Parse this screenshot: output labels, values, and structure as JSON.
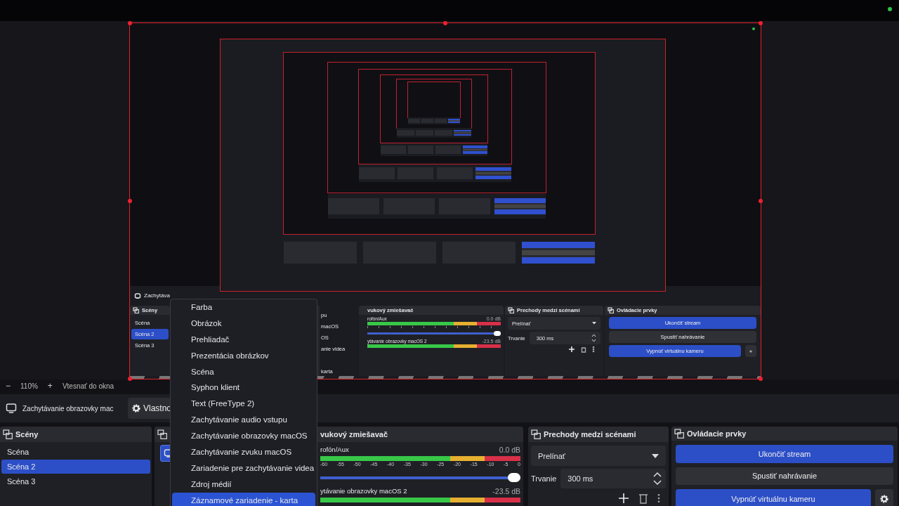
{
  "preview": {
    "nested_capture": {
      "toolbar_source": "Zachytáva",
      "scenes": {
        "title": "Scény",
        "items": [
          {
            "label": "Scéna",
            "selected": false
          },
          {
            "label": "Scéna 2",
            "selected": true
          },
          {
            "label": "Scéna 3",
            "selected": false
          }
        ]
      },
      "menu_fragments": [
        "pu",
        "macOS",
        "OS",
        "anie videa",
        "karta"
      ],
      "mixer": {
        "title": "vukový zmiešavač",
        "channels": [
          {
            "name": "rofón/Aux",
            "reading": "0.0 dB",
            "level": 1
          },
          {
            "name": "ytávanie obrazovky macOS 2",
            "reading": "-23.5 dB"
          }
        ]
      },
      "transitions": {
        "title": "Prechody medzi scénami",
        "transition": "Prelínať",
        "duration_label": "Trvanie",
        "duration": "300 ms"
      },
      "controls": {
        "title": "Ovládacie prvky",
        "buttons": [
          {
            "label": "Ukončiť stream",
            "kind": "primary"
          },
          {
            "label": "Spustiť nahrávanie",
            "kind": "secondary"
          },
          {
            "label": "Vypnúť virtuálnu kameru",
            "kind": "primary"
          }
        ]
      }
    },
    "zoom": {
      "minus": "−",
      "value": "110%",
      "plus": "+",
      "fit": "Vtesnať do okna"
    }
  },
  "source_toolbar": {
    "source": "Zachytávanie obrazovky mac",
    "properties_button": "Vlastno"
  },
  "scenes": {
    "title": "Scény",
    "items": [
      {
        "label": "Scéna",
        "selected": false
      },
      {
        "label": "Scéna 2",
        "selected": true
      },
      {
        "label": "Scéna 3",
        "selected": false
      }
    ]
  },
  "mixer": {
    "title": "vukový zmiešavač",
    "ticks": [
      "-60",
      "-55",
      "-50",
      "-45",
      "-40",
      "-35",
      "-30",
      "-25",
      "-20",
      "-15",
      "-10",
      "-5",
      "0"
    ],
    "channels": [
      {
        "name": "rofón/Aux",
        "reading": "0.0 dB",
        "level": 1
      },
      {
        "name": "ytávanie obrazovky macOS 2",
        "reading": "-23.5 dB"
      }
    ]
  },
  "transitions": {
    "title": "Prechody medzi scénami",
    "transition": "Prelínať",
    "duration_label": "Trvanie",
    "duration": "300 ms"
  },
  "controls": {
    "title": "Ovládacie prvky",
    "buttons": [
      {
        "label": "Ukončiť stream",
        "kind": "primary"
      },
      {
        "label": "Spustiť nahrávanie",
        "kind": "secondary"
      },
      {
        "label": "Vypnúť virtuálnu kameru",
        "kind": "primary"
      }
    ]
  },
  "context_menu": {
    "items": [
      {
        "label": "Farba",
        "selected": false
      },
      {
        "label": "Obrázok",
        "selected": false
      },
      {
        "label": "Prehliadač",
        "selected": false
      },
      {
        "label": "Prezentácia obrázkov",
        "selected": false
      },
      {
        "label": "Scéna",
        "selected": false
      },
      {
        "label": "Syphon klient",
        "selected": false
      },
      {
        "label": "Text (FreeType 2)",
        "selected": false
      },
      {
        "label": "Zachytávanie audio vstupu",
        "selected": false
      },
      {
        "label": "Zachytávanie obrazovky macOS",
        "selected": false
      },
      {
        "label": "Zachytávanie zvuku macOS",
        "selected": false
      },
      {
        "label": "Zariadenie pre zachytávanie videa",
        "selected": false
      },
      {
        "label": "Zdroj médií",
        "selected": false
      },
      {
        "label": "Záznamové zariadenie - karta",
        "selected": true
      }
    ]
  }
}
